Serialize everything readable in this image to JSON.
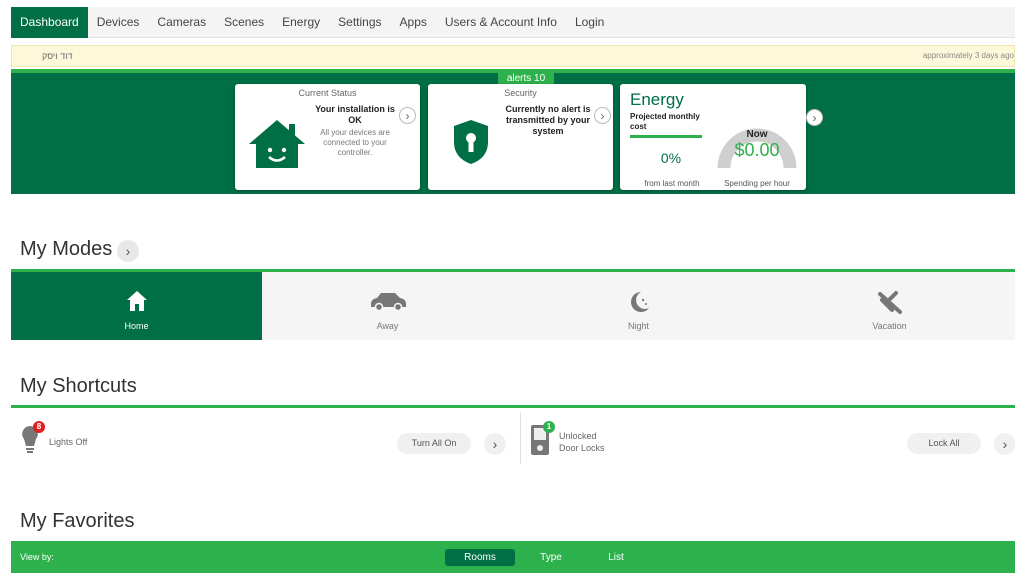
{
  "nav": {
    "items": [
      "Dashboard",
      "Devices",
      "Cameras",
      "Scenes",
      "Energy",
      "Settings",
      "Apps",
      "Users & Account Info",
      "Login"
    ]
  },
  "notice": {
    "left": "דוד ויסק",
    "right": "approximately 3 days ago"
  },
  "alerts_tab": "alerts 10",
  "status_card": {
    "title": "Current Status",
    "headline": "Your installation is OK",
    "sub": "All your devices are connected to your controller."
  },
  "security_card": {
    "title": "Security",
    "headline": "Currently no alert is transmitted by your system"
  },
  "energy_card": {
    "title": "Energy",
    "projected": "Projected monthly cost",
    "percent": "0%",
    "from_label": "from last month",
    "now_label": "Now",
    "now_value": "$0.00",
    "spending_label": "Spending per hour",
    "gauge_fraction": 0
  },
  "modes": {
    "title": "My Modes",
    "items": [
      {
        "label": "Home",
        "icon": "home-icon"
      },
      {
        "label": "Away",
        "icon": "car-icon"
      },
      {
        "label": "Night",
        "icon": "moon-icon"
      },
      {
        "label": "Vacation",
        "icon": "airplane-icon"
      }
    ]
  },
  "shortcuts": {
    "title": "My Shortcuts",
    "lights": {
      "badge": "8",
      "label": "Lights Off",
      "button": "Turn All On",
      "icon": "lightbulb-icon"
    },
    "locks": {
      "badge": "1",
      "label_line1": "Unlocked",
      "label_line2": "Door Locks",
      "button": "Lock All",
      "icon": "door-lock-icon"
    }
  },
  "favorites": {
    "title": "My Favorites",
    "view_by": "View by:",
    "tabs": [
      "Rooms",
      "Type",
      "List"
    ]
  },
  "colors": {
    "dark_green": "#006f45",
    "light_green": "#2db14c",
    "badge_red": "#e02020"
  }
}
